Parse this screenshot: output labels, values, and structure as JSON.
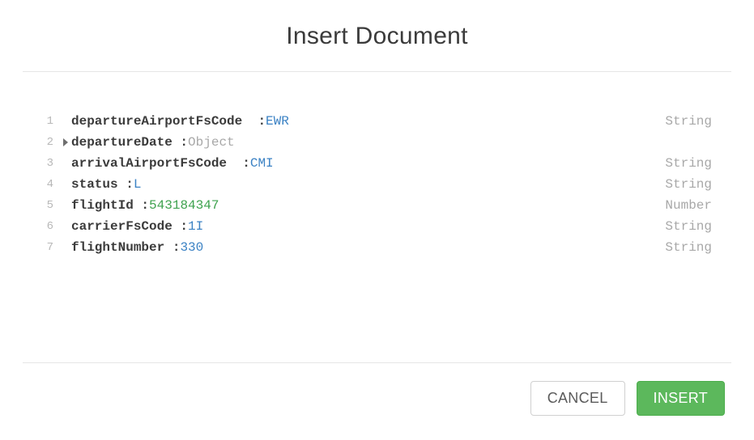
{
  "title": "Insert Document",
  "buttons": {
    "cancel": "CANCEL",
    "insert": "INSERT"
  },
  "fields": [
    {
      "line": "1",
      "key": "departureAirportFsCode ",
      "sep": " :",
      "value": "EWR",
      "valueClass": "val-string",
      "type": "String",
      "expandable": false
    },
    {
      "line": "2",
      "key": "departureDate ",
      "sep": ":",
      "value": "Object",
      "valueClass": "val-object",
      "type": "",
      "expandable": true
    },
    {
      "line": "3",
      "key": "arrivalAirportFsCode ",
      "sep": " :",
      "value": "CMI",
      "valueClass": "val-string",
      "type": "String",
      "expandable": false
    },
    {
      "line": "4",
      "key": "status ",
      "sep": ":",
      "value": "L",
      "valueClass": "val-string",
      "type": "String",
      "expandable": false
    },
    {
      "line": "5",
      "key": "flightId ",
      "sep": ":",
      "value": "543184347",
      "valueClass": "val-number",
      "type": "Number",
      "expandable": false
    },
    {
      "line": "6",
      "key": "carrierFsCode ",
      "sep": ":",
      "value": "1I",
      "valueClass": "val-string",
      "type": "String",
      "expandable": false
    },
    {
      "line": "7",
      "key": "flightNumber ",
      "sep": ":",
      "value": "330",
      "valueClass": "val-string",
      "type": "String",
      "expandable": false
    }
  ]
}
